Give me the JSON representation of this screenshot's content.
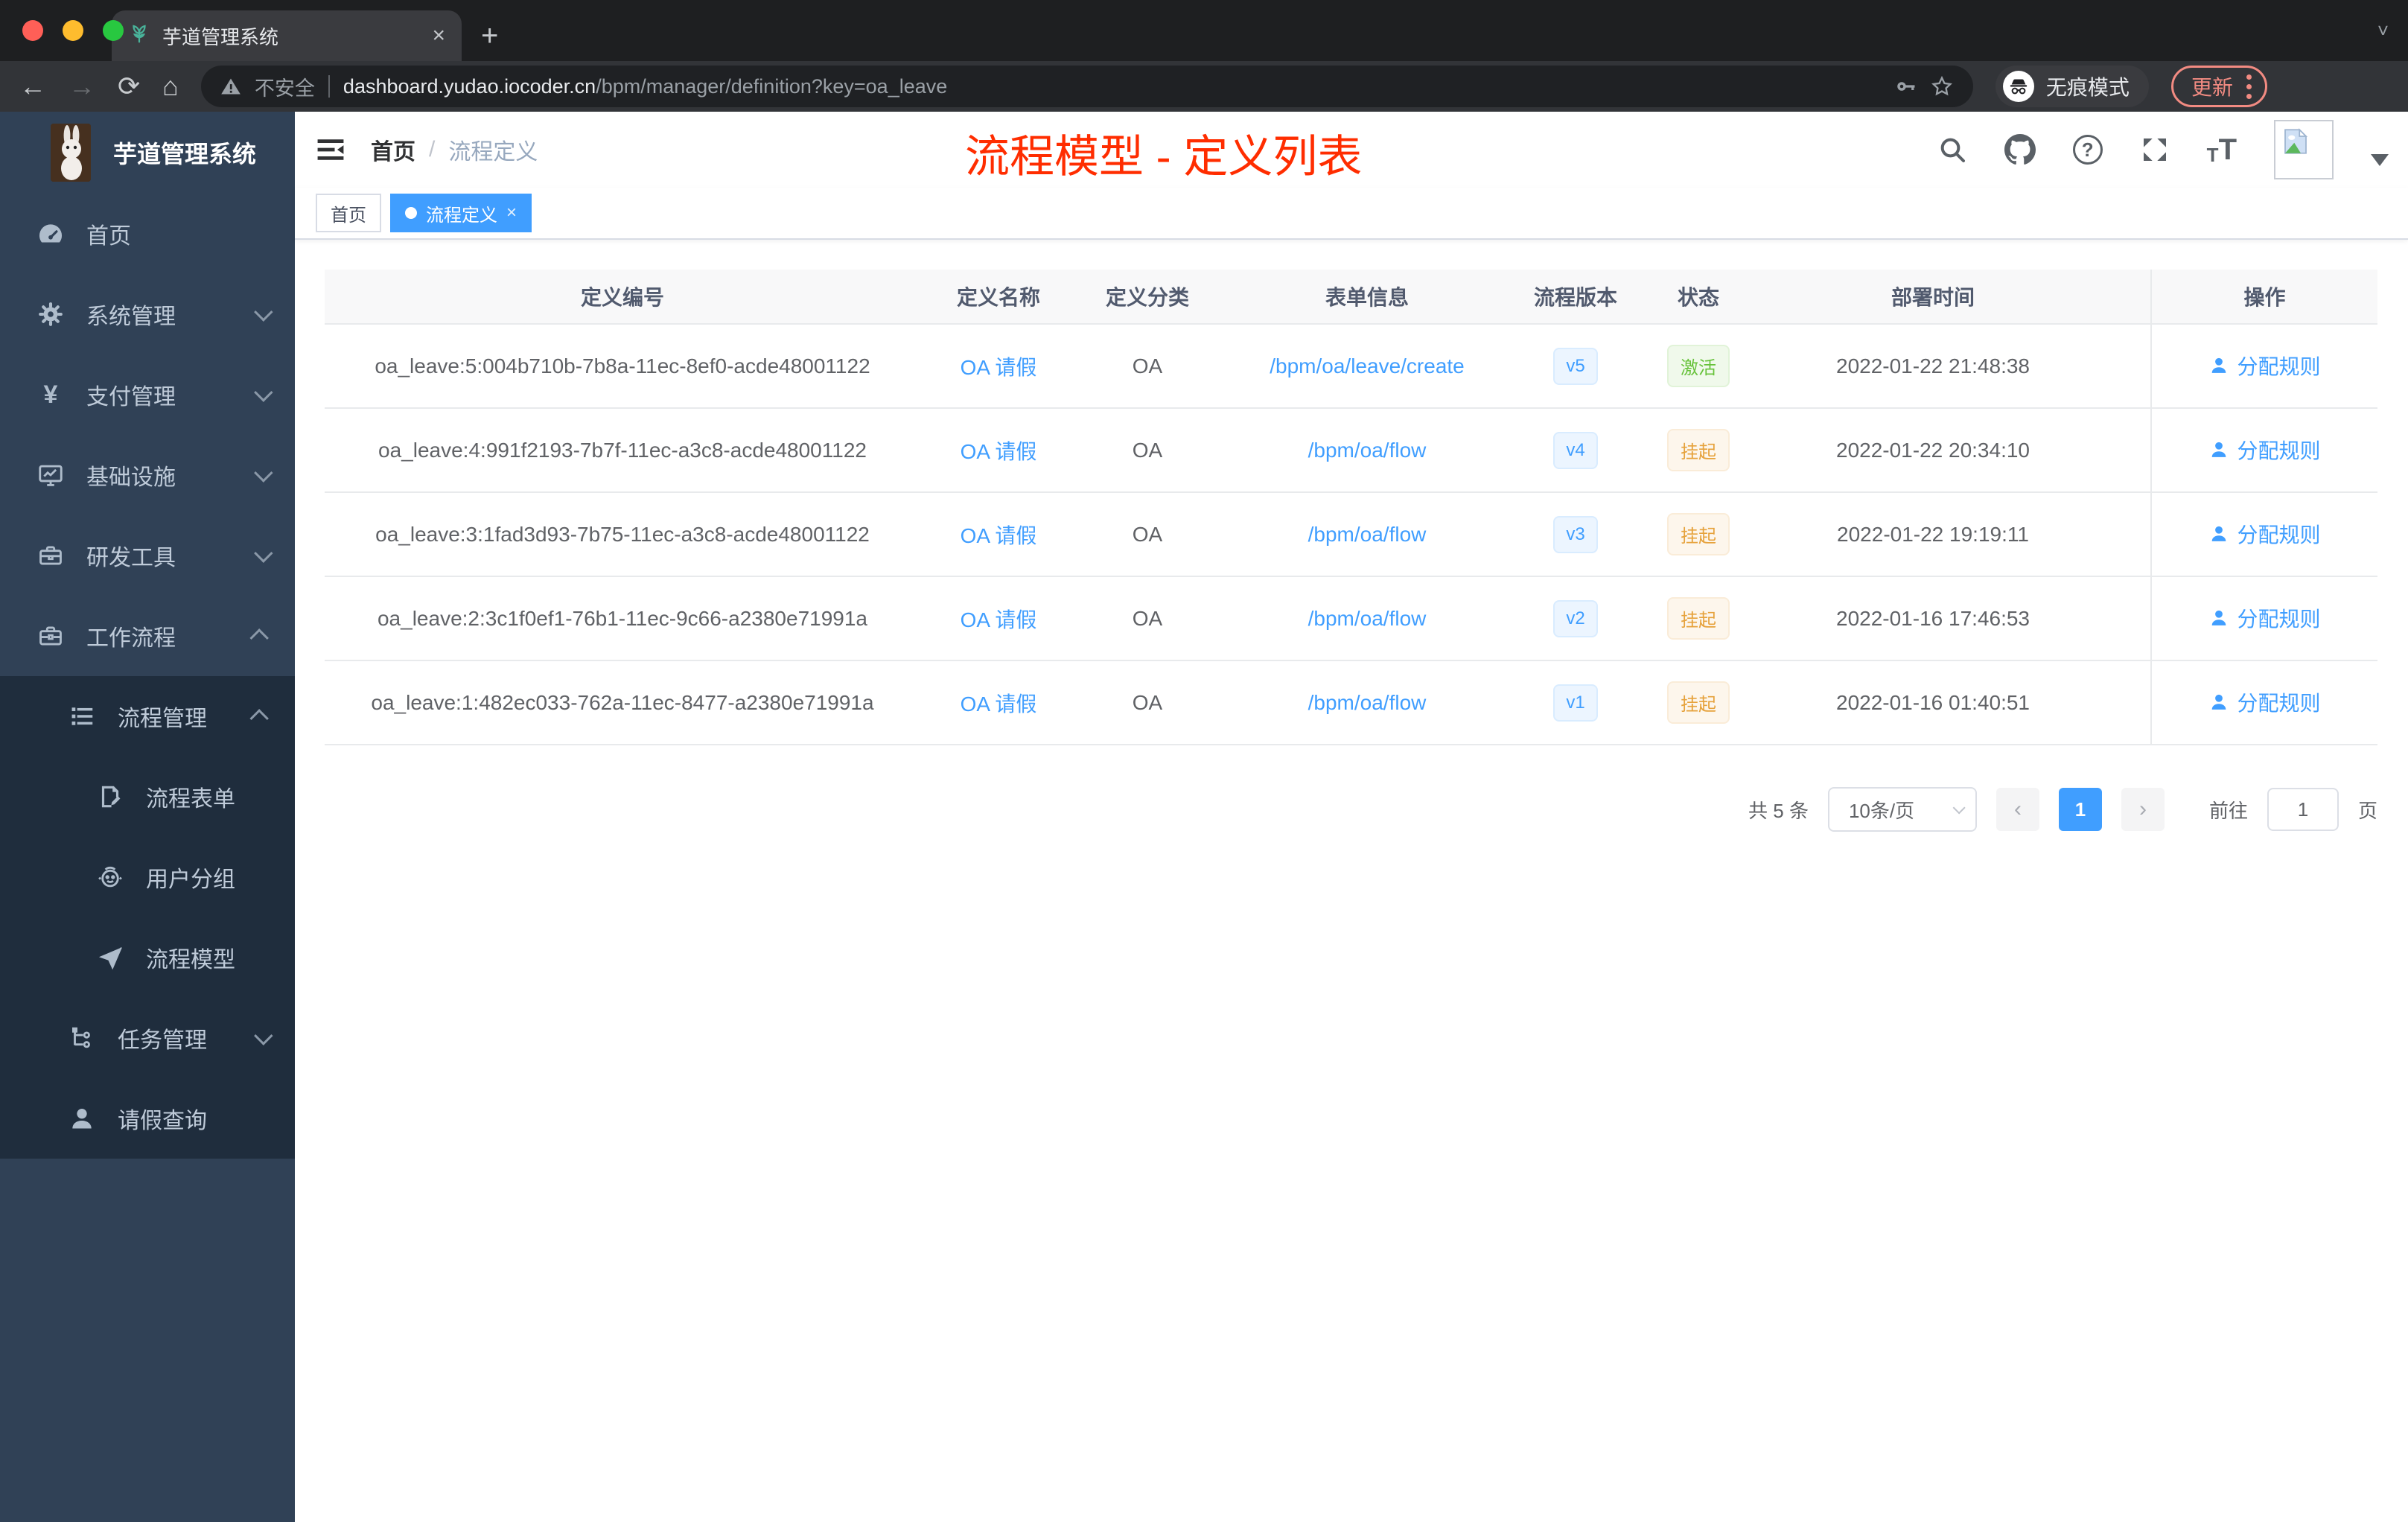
{
  "browser": {
    "tab_title": "芋道管理系统",
    "new_tab": "+",
    "close_tab": "×",
    "security_label": "不安全",
    "url_host": "dashboard.yudao.iocoder.cn",
    "url_path": "/bpm/manager/definition?key=oa_leave",
    "incognito_label": "无痕模式",
    "update_label": "更新"
  },
  "sidebar": {
    "logo_title": "芋道管理系统",
    "items": [
      {
        "label": "首页"
      },
      {
        "label": "系统管理"
      },
      {
        "label": "支付管理"
      },
      {
        "label": "基础设施"
      },
      {
        "label": "研发工具"
      },
      {
        "label": "工作流程"
      }
    ],
    "submenu": [
      {
        "label": "流程管理"
      },
      {
        "label": "流程表单"
      },
      {
        "label": "用户分组"
      },
      {
        "label": "流程模型"
      },
      {
        "label": "任务管理"
      },
      {
        "label": "请假查询"
      }
    ]
  },
  "header": {
    "breadcrumb_home": "首页",
    "breadcrumb_separator": "/",
    "breadcrumb_current": "流程定义",
    "annotation": "流程模型 - 定义列表"
  },
  "tags": [
    {
      "label": "首页"
    },
    {
      "label": "流程定义",
      "close": "×"
    }
  ],
  "table": {
    "columns": [
      "定义编号",
      "定义名称",
      "定义分类",
      "表单信息",
      "流程版本",
      "状态",
      "部署时间",
      "操作"
    ],
    "rows": [
      {
        "id": "oa_leave:5:004b710b-7b8a-11ec-8ef0-acde48001122",
        "name": "OA 请假",
        "category": "OA",
        "form": "/bpm/oa/leave/create",
        "version": "v5",
        "status": "激活",
        "status_type": "success",
        "time": "2022-01-22 21:48:38",
        "action": "分配规则"
      },
      {
        "id": "oa_leave:4:991f2193-7b7f-11ec-a3c8-acde48001122",
        "name": "OA 请假",
        "category": "OA",
        "form": "/bpm/oa/flow",
        "version": "v4",
        "status": "挂起",
        "status_type": "warning",
        "time": "2022-01-22 20:34:10",
        "action": "分配规则"
      },
      {
        "id": "oa_leave:3:1fad3d93-7b75-11ec-a3c8-acde48001122",
        "name": "OA 请假",
        "category": "OA",
        "form": "/bpm/oa/flow",
        "version": "v3",
        "status": "挂起",
        "status_type": "warning",
        "time": "2022-01-22 19:19:11",
        "action": "分配规则"
      },
      {
        "id": "oa_leave:2:3c1f0ef1-76b1-11ec-9c66-a2380e71991a",
        "name": "OA 请假",
        "category": "OA",
        "form": "/bpm/oa/flow",
        "version": "v2",
        "status": "挂起",
        "status_type": "warning",
        "time": "2022-01-16 17:46:53",
        "action": "分配规则"
      },
      {
        "id": "oa_leave:1:482ec033-762a-11ec-8477-a2380e71991a",
        "name": "OA 请假",
        "category": "OA",
        "form": "/bpm/oa/flow",
        "version": "v1",
        "status": "挂起",
        "status_type": "warning",
        "time": "2022-01-16 01:40:51",
        "action": "分配规则"
      }
    ]
  },
  "pagination": {
    "total_label": "共 5 条",
    "page_size": "10条/页",
    "prev": "‹",
    "current_page": "1",
    "next": "›",
    "goto_label": "前往",
    "goto_value": "1",
    "page_unit": "页"
  },
  "colors": {
    "accent_blue": "#409eff",
    "annotation_red": "#ff2d00",
    "sidebar_bg": "#304156",
    "submenu_bg": "#1f2d3d",
    "status_active_green": "#67c23a",
    "status_suspend_orange": "#e6a23c",
    "traffic_red": "#ff5f57",
    "traffic_yellow": "#febc2e",
    "traffic_green": "#28c840",
    "update_red": "#f28b82"
  }
}
